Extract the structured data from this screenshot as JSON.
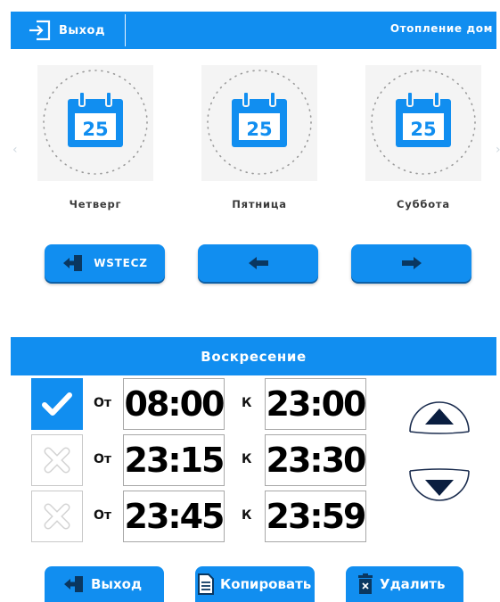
{
  "header": {
    "exit_label": "Выход",
    "title": "Отопление дом"
  },
  "days": [
    {
      "label": "Четверг",
      "day_number": "25"
    },
    {
      "label": "Пятница",
      "day_number": "25"
    },
    {
      "label": "Суббота",
      "day_number": "25"
    }
  ],
  "nav": {
    "back_label": "WSTECZ"
  },
  "schedule": {
    "day_title": "Воскресение",
    "from_label": "От",
    "to_label": "К",
    "rows": [
      {
        "enabled": true,
        "from": "08:00",
        "to": "23:00"
      },
      {
        "enabled": false,
        "from": "23:15",
        "to": "23:30"
      },
      {
        "enabled": false,
        "from": "23:45",
        "to": "23:59"
      }
    ]
  },
  "footer": {
    "exit_label": "Выход",
    "copy_label": "Копировать",
    "delete_label": "Удалить"
  },
  "colors": {
    "accent": "#118ef0",
    "background": "#ffffff",
    "tile": "#f4f4f4"
  },
  "icons": [
    "exit-icon",
    "calendar-icon",
    "back-door-icon",
    "arrow-left-icon",
    "arrow-right-icon",
    "checkmark-icon",
    "cross-icon",
    "arrow-up-icon",
    "arrow-down-icon",
    "document-icon",
    "trash-icon"
  ]
}
